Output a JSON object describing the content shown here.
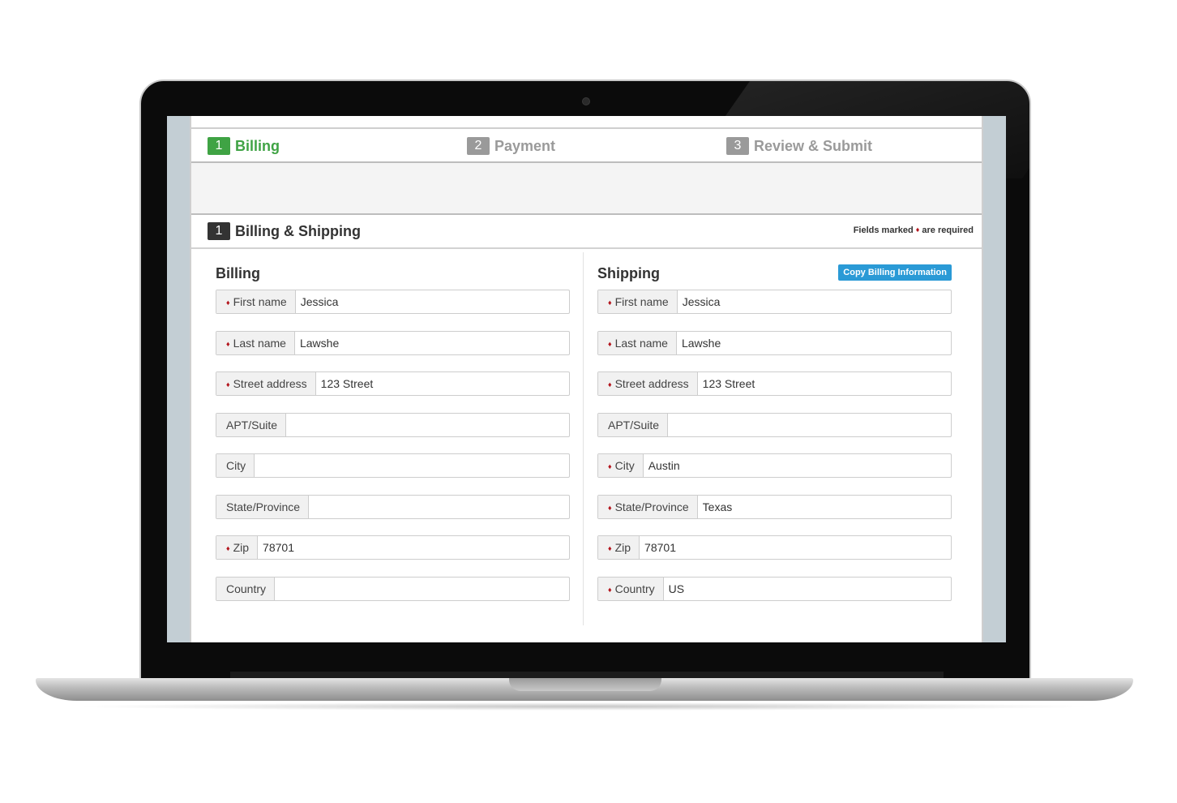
{
  "steps": [
    {
      "number": "1",
      "label": "Billing",
      "active": true
    },
    {
      "number": "2",
      "label": "Payment",
      "active": false
    },
    {
      "number": "3",
      "label": "Review & Submit",
      "active": false
    }
  ],
  "section": {
    "number": "1",
    "title": "Billing & Shipping",
    "required_note_prefix": "Fields marked",
    "required_marker": "♦",
    "required_note_suffix": "are required"
  },
  "billing": {
    "title": "Billing",
    "fields": [
      {
        "label": "First name",
        "required": true,
        "value": "Jessica"
      },
      {
        "label": "Last name",
        "required": true,
        "value": "Lawshe"
      },
      {
        "label": "Street address",
        "required": true,
        "value": "123 Street"
      },
      {
        "label": "APT/Suite",
        "required": false,
        "value": ""
      },
      {
        "label": "City",
        "required": false,
        "value": ""
      },
      {
        "label": "State/Province",
        "required": false,
        "value": ""
      },
      {
        "label": "Zip",
        "required": true,
        "value": "78701"
      },
      {
        "label": "Country",
        "required": false,
        "value": ""
      }
    ]
  },
  "shipping": {
    "title": "Shipping",
    "copy_button_label": "Copy Billing Information",
    "fields": [
      {
        "label": "First name",
        "required": true,
        "value": "Jessica"
      },
      {
        "label": "Last name",
        "required": true,
        "value": "Lawshe"
      },
      {
        "label": "Street address",
        "required": true,
        "value": "123 Street"
      },
      {
        "label": "APT/Suite",
        "required": false,
        "value": ""
      },
      {
        "label": "City",
        "required": true,
        "value": "Austin"
      },
      {
        "label": "State/Province",
        "required": true,
        "value": "Texas"
      },
      {
        "label": "Zip",
        "required": true,
        "value": "78701"
      },
      {
        "label": "Country",
        "required": true,
        "value": "US"
      }
    ]
  },
  "colors": {
    "active_step": "#3fa344",
    "inactive_step": "#9a9a9a",
    "required_marker": "#b3141c",
    "copy_button": "#2a9ad6"
  }
}
